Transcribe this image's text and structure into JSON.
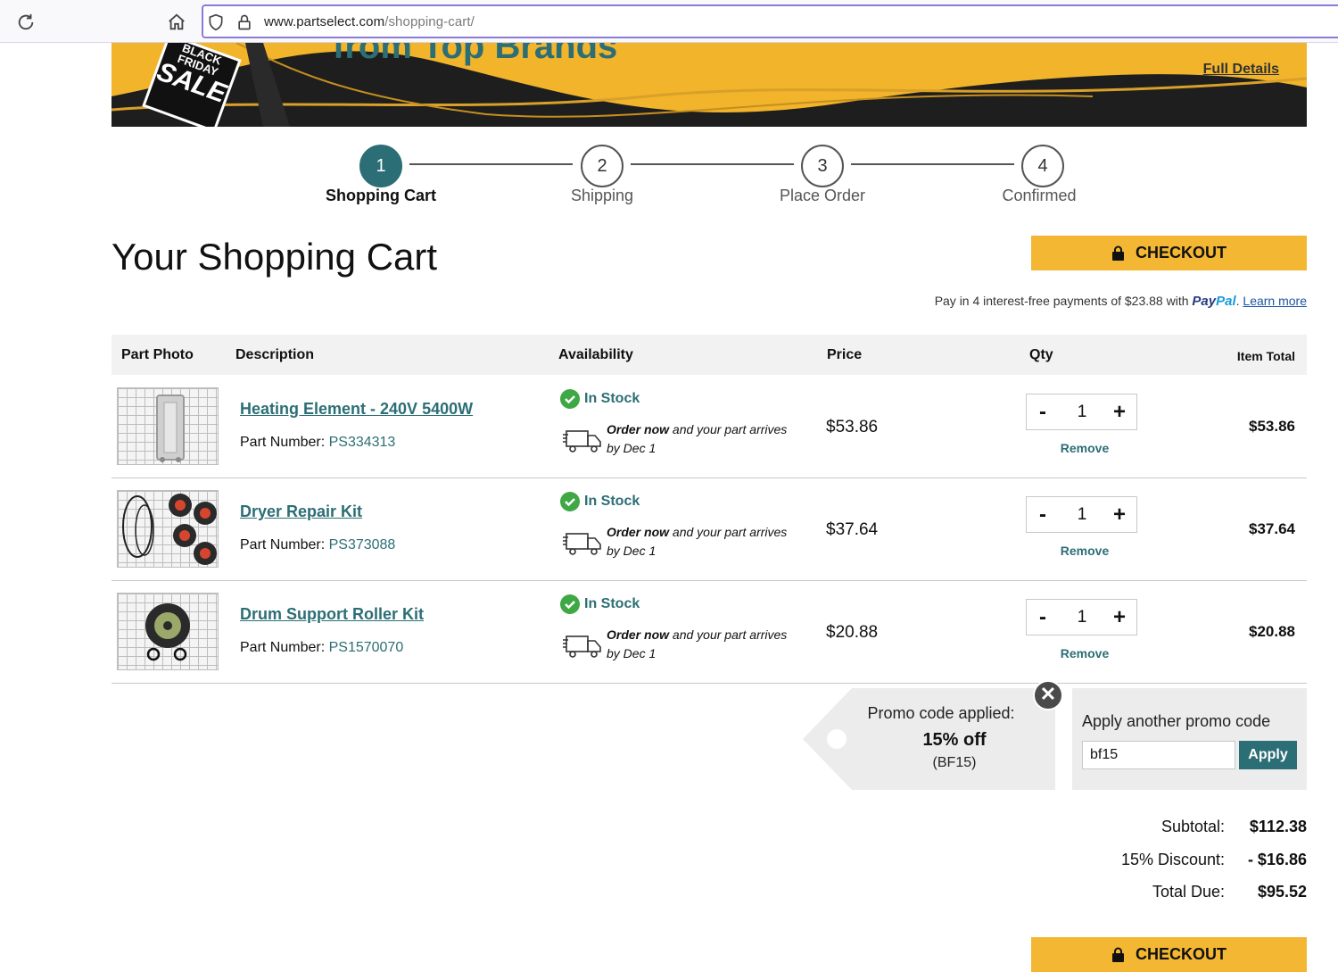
{
  "browser": {
    "url_domain": "www.partselect.com",
    "url_path": "/shopping-cart/"
  },
  "banner": {
    "badge_line1": "BLACK",
    "badge_line2": "FRIDAY",
    "badge_line3": "SALE",
    "headline": "from Top Brands",
    "full_details": "Full Details"
  },
  "steps": [
    {
      "num": "1",
      "label": "Shopping Cart"
    },
    {
      "num": "2",
      "label": "Shipping"
    },
    {
      "num": "3",
      "label": "Place Order"
    },
    {
      "num": "4",
      "label": "Confirmed"
    }
  ],
  "page_title": "Your Shopping Cart",
  "checkout_label": "CHECKOUT",
  "paypal": {
    "text": "Pay in 4 interest-free payments of $23.88 with",
    "logo_pay": "Pay",
    "logo_pal": "Pal",
    "dot": ".",
    "learn_more": "Learn more"
  },
  "table": {
    "headers": {
      "photo": "Part Photo",
      "description": "Description",
      "availability": "Availability",
      "price": "Price",
      "qty": "Qty",
      "total": "Item Total"
    },
    "rows": [
      {
        "name": "Heating Element - 240V 5400W",
        "part_label": "Part Number:",
        "part_number": "PS334313",
        "stock": "In Stock",
        "order_now": "Order now",
        "arrives": "and your part arrives",
        "by_date": "by Dec 1",
        "price": "$53.86",
        "qty": "1",
        "remove": "Remove",
        "item_total": "$53.86"
      },
      {
        "name": "Dryer Repair Kit",
        "part_label": "Part Number:",
        "part_number": "PS373088",
        "stock": "In Stock",
        "order_now": "Order now",
        "arrives": "and your part arrives",
        "by_date": "by Dec 1",
        "price": "$37.64",
        "qty": "1",
        "remove": "Remove",
        "item_total": "$37.64"
      },
      {
        "name": "Drum Support Roller Kit",
        "part_label": "Part Number:",
        "part_number": "PS1570070",
        "stock": "In Stock",
        "order_now": "Order now",
        "arrives": "and your part arrives",
        "by_date": "by Dec 1",
        "price": "$20.88",
        "qty": "1",
        "remove": "Remove",
        "item_total": "$20.88"
      }
    ],
    "minus": "-",
    "plus": "+"
  },
  "promo": {
    "applied_label": "Promo code applied:",
    "amount": "15% off",
    "code": "(BF15)",
    "close": "✕",
    "another_label": "Apply another promo code",
    "input_value": "bf15",
    "apply_label": "Apply"
  },
  "summary": {
    "subtotal_label": "Subtotal:",
    "subtotal": "$112.38",
    "discount_label": "15% Discount:",
    "discount": "- $16.86",
    "total_label": "Total Due:",
    "total": "$95.52"
  },
  "colors": {
    "teal": "#2c6e75",
    "checkout_yellow": "#f3b733",
    "banner_yellow": "#f1b42b",
    "stock_green": "#3ea845"
  }
}
